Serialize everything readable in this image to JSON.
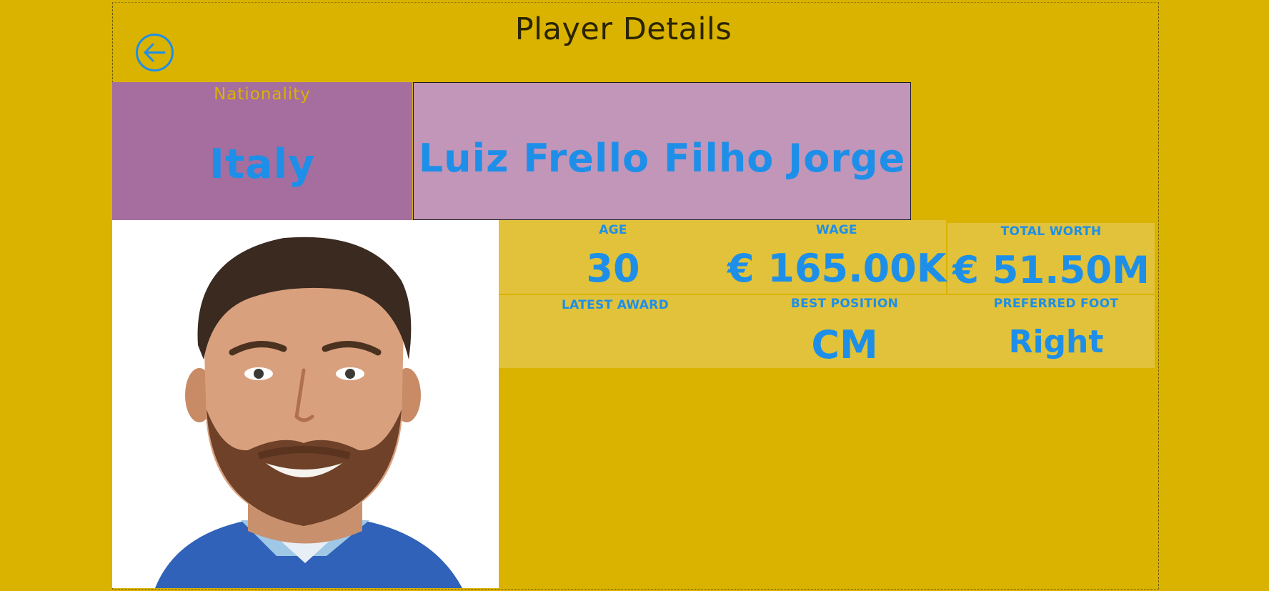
{
  "header": {
    "title": "Player Details",
    "back_icon": "arrow-left-circle-icon"
  },
  "nationality": {
    "label": "Nationality",
    "value": "Italy"
  },
  "player": {
    "name": "Luiz Frello Filho Jorge",
    "photo_icon": "player-headshot"
  },
  "stats": {
    "age": {
      "label": "AGE",
      "value": "30"
    },
    "wage": {
      "label": "WAGE",
      "value": "€ 165.00K"
    },
    "total_worth": {
      "label": "TOTAL WORTH",
      "value": "€ 51.50M"
    },
    "latest_award": {
      "label": "LATEST AWARD",
      "value": ""
    },
    "best_position": {
      "label": "BEST POSITION",
      "value": "CM"
    },
    "preferred_foot": {
      "label": "PREFERRED FOOT",
      "value": "Right"
    }
  },
  "colors": {
    "background": "#dab200",
    "nationality_card": "#a56e9e",
    "name_card": "#c196b9",
    "stat_card": "#e1c23a",
    "accent_blue": "#1e8fe8"
  }
}
